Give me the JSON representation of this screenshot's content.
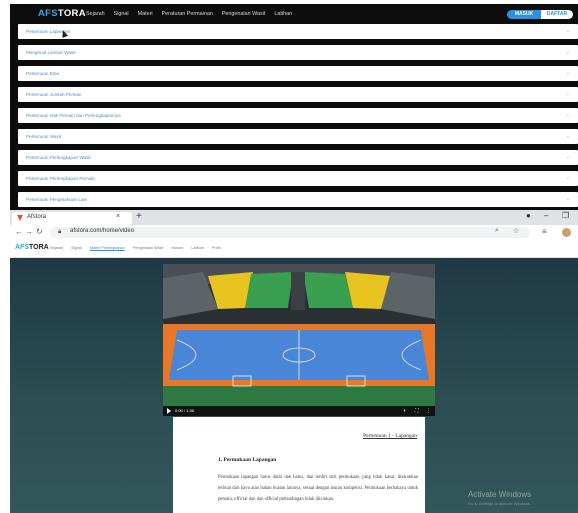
{
  "top_site": {
    "brand_a": "AFS",
    "brand_b": "TORA",
    "nav": [
      "Sejarah",
      "Signal",
      "Materi",
      "Peraturan Permainan",
      "Pengenalan Wasit",
      "Latihan"
    ],
    "masuk": "MASUK",
    "daftar": "DAFTAR",
    "accordion": [
      "Pertemuan Lapangan",
      "Mengenal Lambar Wasit",
      "Pertemuan Bola",
      "Pertemuan Jumlah Pemain",
      "Pertemuan Hak Pemain dan Perlengkapannya",
      "Pertemuan Wasit",
      "Pertemuan Perlengkapan Wasit",
      "Pertemuan Perlengkapan Pemain",
      "Pertemuan Pengetahuan Lain"
    ]
  },
  "browser": {
    "tab_title": "Afstora",
    "url": "afstora.com/home/video",
    "site_brand_a": "AFS",
    "site_brand_b": "TORA",
    "site_nav": [
      "Sejarah",
      "Signal",
      "Materi Perlengkapan",
      "Pengenalan Wasit",
      "Hukum",
      "Latihan",
      "Profil"
    ],
    "site_nav_active_index": 2,
    "video_time": "0:00 / 1:38",
    "doc": {
      "pertemuan_label": "Pertemuan 1 - Lapangan",
      "section_title": "1.   Permukaan Lapangan",
      "paragraph": "Permukaan lapangan harus datar dan halus, dan terdiri dari permukaan yang tidak kasar, disarankan terbuat dari kayu atau bahan buatan lainnya, sesuai dengan aturan kompetisi. Permukaan berbahaya untuk pemain, official dan dan official pertandingan tidak diizinkan."
    },
    "watermark": "Activate Windows",
    "watermark_sub": "Go to Settings to activate Windows."
  },
  "colors": {
    "accent": "#2f8fe0",
    "brand_blue": "#37a7e8",
    "court_blue": "#4a86d8",
    "court_orange": "#e87828",
    "seat_yellow": "#e8c420",
    "seat_green": "#3aa050"
  }
}
